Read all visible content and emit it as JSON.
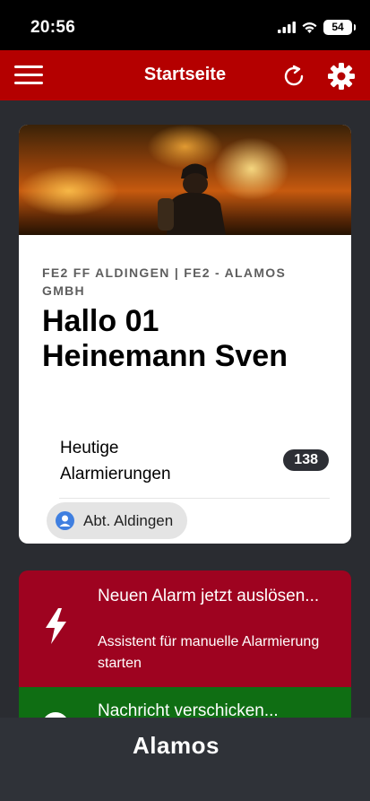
{
  "status_bar": {
    "time": "20:56",
    "battery": "54"
  },
  "header": {
    "title": "Startseite"
  },
  "profile": {
    "organization": "FE2 FF ALDINGEN | FE2 - ALAMOS GMBH",
    "greeting_line1": "Hallo 01",
    "greeting_line2": "Heinemann Sven",
    "alarms_label": "Heutige Alarmierungen",
    "alarms_count": "138",
    "unit": "Abt. Aldingen"
  },
  "actions": {
    "alarm": {
      "title": "Neuen Alarm jetzt auslösen...",
      "subtitle": "Assistent für manuelle Alarmierung starten",
      "color": "#9e0320"
    },
    "message": {
      "title": "Nachricht verschicken...",
      "color": "#0f6e13"
    }
  },
  "footer": {
    "logo": "Alamos"
  },
  "colors": {
    "header": "#b40000",
    "background": "#2a2c31"
  }
}
